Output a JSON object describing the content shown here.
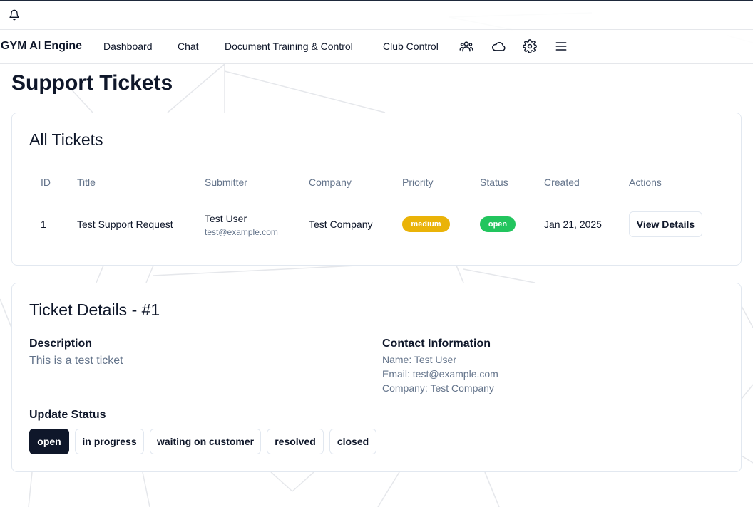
{
  "colors": {
    "medium_priority": "#eab308",
    "open_status": "#22c55e",
    "primary_dark": "#0f172a",
    "muted_text": "#64748b",
    "border": "#e2e8f0"
  },
  "topbar": {
    "icon": "bell-icon"
  },
  "nav": {
    "brand": "GYM AI Engine",
    "links": [
      "Dashboard",
      "Chat",
      "Document Training & Control",
      "Club Control"
    ],
    "icons": [
      "users-icon",
      "cloud-icon",
      "settings-icon",
      "menu-icon"
    ]
  },
  "page": {
    "title": "Support Tickets"
  },
  "tickets": {
    "title": "All Tickets",
    "columns": [
      "ID",
      "Title",
      "Submitter",
      "Company",
      "Priority",
      "Status",
      "Created",
      "Actions"
    ],
    "rows": [
      {
        "id": "1",
        "title": "Test Support Request",
        "submitter_name": "Test User",
        "submitter_email": "test@example.com",
        "company": "Test Company",
        "priority": "medium",
        "status": "open",
        "created": "Jan 21, 2025",
        "action": "View Details"
      }
    ]
  },
  "details": {
    "title": "Ticket Details - #1",
    "description_label": "Description",
    "description": "This is a test ticket",
    "contact_label": "Contact Information",
    "contact_name": "Name: Test User",
    "contact_email": "Email: test@example.com",
    "contact_company": "Company: Test Company",
    "update_label": "Update Status",
    "status_options": [
      "open",
      "in progress",
      "waiting on customer",
      "resolved",
      "closed"
    ],
    "selected_status": "open"
  }
}
